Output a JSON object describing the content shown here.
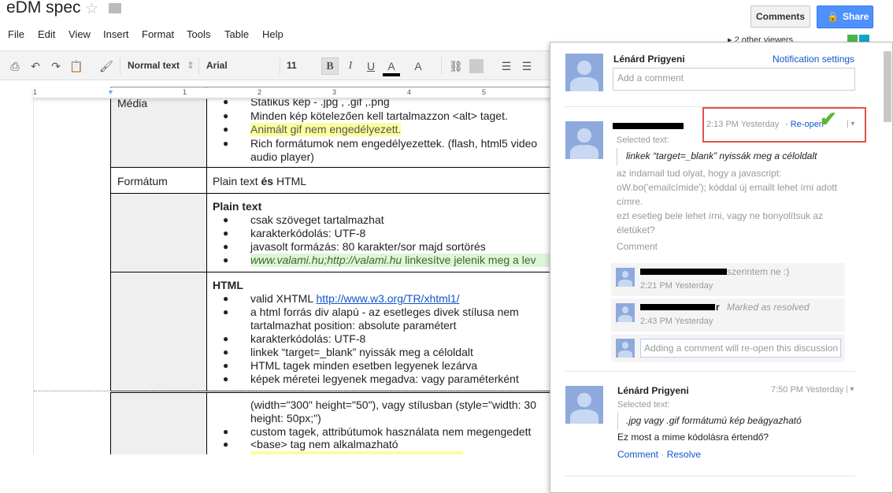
{
  "app": {
    "title": "eDM spec",
    "star_icon": "star-icon",
    "folder_icon": "folder-icon"
  },
  "menu": [
    "File",
    "Edit",
    "View",
    "Insert",
    "Format",
    "Tools",
    "Table",
    "Help"
  ],
  "toolbar": {
    "style": "Normal text",
    "font": "Arial",
    "size": "11",
    "bold": "B",
    "italic": "I",
    "underline": "U",
    "text_color": "A",
    "highlight": "A"
  },
  "ruler": [
    "1",
    "1",
    "2",
    "3",
    "4",
    "5"
  ],
  "header": {
    "comments_label": "Comments",
    "share_label": "Share",
    "viewers": "2 other viewers"
  },
  "doc": {
    "media_label": "Média",
    "media_items": [
      "Statikus kép - .jpg , .gif ,.png",
      "Minden kép kötelezően kell tartalmazzon <alt> taget.",
      "Animált gif nem engedélyezett.",
      "Rich formátumok nem engedélyezettek. (flash, html5 video",
      "audio player)"
    ],
    "format_label": "Formátum",
    "format_value_a": "Plain text ",
    "format_value_b": "és",
    "format_value_c": " HTML",
    "plain_heading": "Plain text",
    "plain_items": [
      "csak szöveget tartalmazhat",
      "karakterkódolás: UTF-8",
      "javasolt formázás: 80 karakter/sor majd sortörés",
      "www.valami.hu;http://valami.hu",
      "linkesítve jelenik meg a lev"
    ],
    "html_heading": "HTML",
    "html_items": [
      "valid XHTML ",
      "http://www.w3.org/TR/xhtml1/",
      "a html forrás div alapú - az esetleges divek stílusa nem",
      "tartalmazhat position: absolute paramétert",
      "karakterkódolás: UTF-8",
      "linkek “target=_blank” nyissák meg a céloldalt",
      "HTML tagek minden esetben legyenek lezárva",
      "képek méretei legyenek megadva: vagy paraméterként"
    ],
    "page2_items": [
      "(width=\"300\" height=\"50\"), vagy stílusban (style=\"width: 30",
      "height: 50px;\")",
      "custom tagek, attribútumok használata nem megengedett",
      "<base> tag nem alkalmazható"
    ]
  },
  "comments": {
    "current_user": "Lénárd Prigyeni",
    "notification_settings": "Notification settings",
    "add_placeholder": "Add a comment",
    "thread1": {
      "time": "2:13 PM Yesterday",
      "reopen": "Re-open",
      "selected_label": "Selected text:",
      "quote": "linkek “target=_blank” nyissák meg a céloldalt",
      "body": [
        "az indamail tud olyat, hogy a javascript:",
        "oW.bo('emailcímide'); kóddal új emailt lehet írni adott",
        "címre.",
        "ezt esetleg bele lehet írni, vagy ne bonyolítsuk az",
        "életüket?"
      ],
      "comment_link": "Comment",
      "replies": [
        {
          "text": "szerintem ne :)",
          "time": "2:21 PM Yesterday"
        },
        {
          "text": "r",
          "status": "Marked as resolved",
          "time": "2:43 PM Yesterday"
        }
      ],
      "reply_placeholder": "Adding a comment will re-open this discussion"
    },
    "thread2": {
      "author": "Lénárd Prigyeni",
      "time": "7:50 PM Yesterday",
      "selected_label": "Selected text:",
      "quote": ".jpg vagy .gif formátumú kép beágyazható",
      "body": "Ez most a mime kódolásra értendő?",
      "comment_link": "Comment",
      "resolve_link": "Resolve"
    }
  },
  "colors": {
    "share": "#4d90fe",
    "link": "#1155cc",
    "highlight_box": "#e0524a",
    "check": "#5cb82e"
  }
}
